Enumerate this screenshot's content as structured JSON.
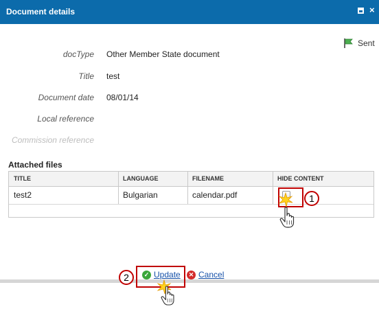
{
  "window": {
    "title": "Document details",
    "close_glyph": "×"
  },
  "status": {
    "label": "Sent",
    "icon": "green-flag-icon"
  },
  "fields": [
    {
      "label": "docType",
      "value": "Other Member State document"
    },
    {
      "label": "Title",
      "value": "test"
    },
    {
      "label": "Document date",
      "value": "08/01/14"
    },
    {
      "label": "Local reference",
      "value": ""
    },
    {
      "label": "Commission reference",
      "value": ""
    }
  ],
  "attached": {
    "title": "Attached files",
    "columns": [
      "TITLE",
      "LANGUAGE",
      "FILENAME",
      "HIDE CONTENT"
    ],
    "rows": [
      {
        "title": "test2",
        "language": "Bulgarian",
        "filename": "calendar.pdf",
        "hide_content": false
      }
    ]
  },
  "callouts": [
    "1",
    "2"
  ],
  "actions": {
    "update_label": "Update",
    "cancel_label": "Cancel"
  },
  "colors": {
    "titlebar": "#0c6bab",
    "highlight": "#c00000",
    "link": "#1550a8",
    "update_icon": "#3aa63a",
    "cancel_icon": "#d42b2b"
  }
}
